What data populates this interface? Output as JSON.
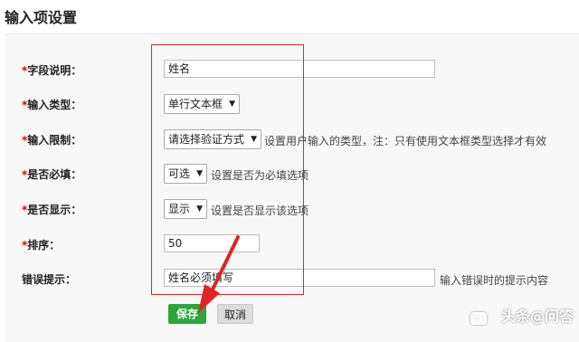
{
  "page": {
    "title": "输入项设置"
  },
  "form": {
    "rows": [
      {
        "required": "*",
        "label": "字段说明：",
        "value": "姓名"
      },
      {
        "required": "*",
        "label": "输入类型：",
        "value": "单行文本框"
      },
      {
        "required": "*",
        "label": "输入限制：",
        "value": "请选择验证方式",
        "hint": "设置用户输入的类型，注：只有使用文本框类型选择才有效"
      },
      {
        "required": "*",
        "label": "是否必填：",
        "value": "可选",
        "hint": "设置是否为必填选项"
      },
      {
        "required": "*",
        "label": "是否显示：",
        "value": "显示",
        "hint": "设置是否显示该选项"
      },
      {
        "required": "*",
        "label": "排序：",
        "value": "50"
      },
      {
        "required": "",
        "label": "错误提示：",
        "value": "姓名必须填写",
        "hint": "输入错误时的提示内容"
      }
    ],
    "dropdown_arrow": "▼"
  },
  "buttons": {
    "save": "保存",
    "cancel": "取消"
  },
  "watermark": {
    "text": "头条@问答",
    "icon": "chat-bubble-icon"
  },
  "colors": {
    "required": "#e00000",
    "save_button": "#2da63a",
    "annotation": "#e02424"
  }
}
